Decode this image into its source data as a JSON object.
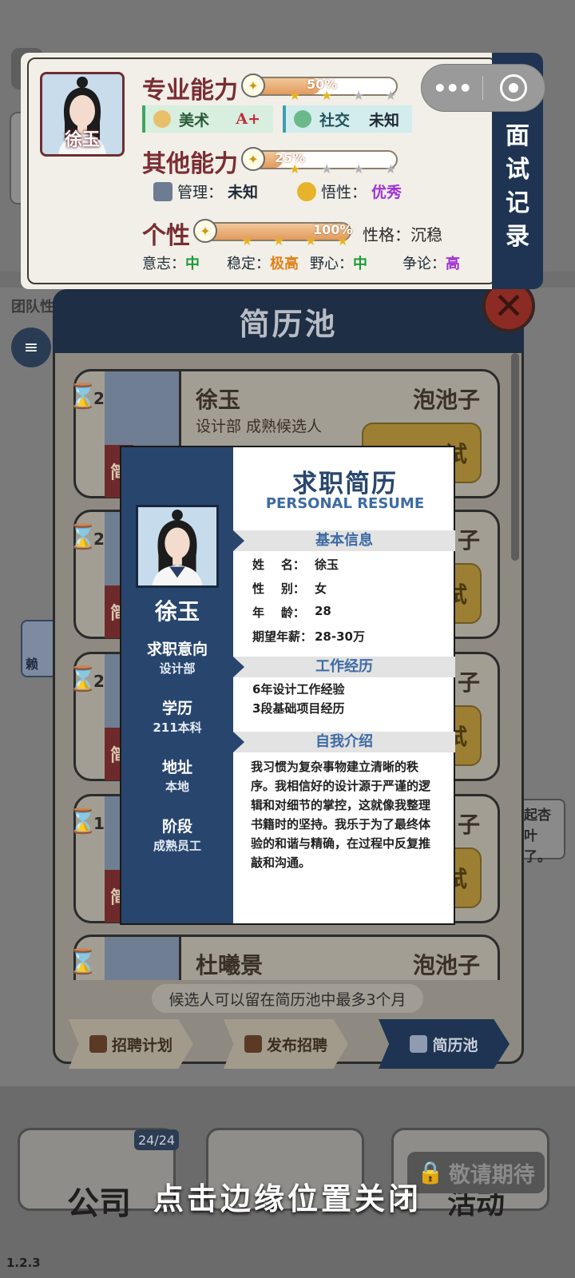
{
  "ability_panel": {
    "professional": {
      "heading": "专业能力",
      "percent_text": "50%",
      "percent": 50,
      "stars_filled": 2,
      "stars_total": 4
    },
    "skills": [
      {
        "icon": "palette-icon",
        "label": "美术",
        "value": "A+"
      },
      {
        "icon": "chat-bubble-icon",
        "label": "社交",
        "value": "未知"
      }
    ],
    "other": {
      "heading": "其他能力",
      "percent_text": "25%",
      "percent": 25,
      "stars_filled": 1,
      "stars_total": 4
    },
    "other_items": [
      {
        "icon": "team-icon",
        "label": "管理：",
        "value": "未知"
      },
      {
        "icon": "lightbulb-icon",
        "label": "悟性：",
        "value": "优秀"
      }
    ],
    "personality": {
      "heading": "个性",
      "percent_text": "100%",
      "percent": 100,
      "stars_filled": 4,
      "stars_total": 4,
      "character_label": "性格：",
      "character_value": "沉稳"
    },
    "traits": [
      {
        "label": "意志：",
        "value": "中",
        "color": "#1d9a38"
      },
      {
        "label": "稳定：",
        "value": "极高",
        "color": "#e0821a"
      },
      {
        "label": "野心：",
        "value": "中",
        "color": "#1d9a38"
      },
      {
        "label": "争论：",
        "value": "高",
        "color": "#a232d6"
      }
    ],
    "avatar_name": "徐玉",
    "interview_record": [
      "面",
      "试",
      "记",
      "录"
    ]
  },
  "background": {
    "team_label": "团队性",
    "lai_name": "赖",
    "side_bubble": [
      "起杏叶",
      "了。"
    ]
  },
  "pool": {
    "title": "简历池",
    "note": "候选人可以留在简历池中最多3个月",
    "tabs": [
      {
        "label": "招聘计划",
        "icon": "recruit-plan-icon"
      },
      {
        "label": "发布招聘",
        "icon": "publish-icon"
      },
      {
        "label": "简历池",
        "icon": "stack-icon"
      }
    ],
    "candidates": [
      {
        "wait": "2",
        "name": "徐玉",
        "sub": "设计部  成熟候选人",
        "source": "泡池子",
        "tag": "简",
        "button": "试"
      },
      {
        "wait": "2",
        "name": "",
        "sub": "",
        "source": "子",
        "tag": "简",
        "button": "试"
      },
      {
        "wait": "2",
        "name": "",
        "sub": "",
        "source": "子",
        "tag": "简",
        "button": "试"
      },
      {
        "wait": "1",
        "name": "",
        "sub": "",
        "source": "子",
        "tag": "简",
        "button": "试"
      },
      {
        "wait": "",
        "name": "杜曦景",
        "sub": "",
        "source": "泡池子",
        "tag": "",
        "button": ""
      }
    ]
  },
  "resume": {
    "title": "求职简历",
    "subtitle": "PERSONAL RESUME",
    "name": "徐玉",
    "left_fields": [
      {
        "label": "求职意向",
        "value": "设计部"
      },
      {
        "label": "学历",
        "value": "211本科"
      },
      {
        "label": "地址",
        "value": "本地"
      },
      {
        "label": "阶段",
        "value": "成熟员工"
      }
    ],
    "basic_title": "基本信息",
    "basic": [
      {
        "key": "姓    名：",
        "value": "徐玉"
      },
      {
        "key": "性    别：",
        "value": "女"
      },
      {
        "key": "年    龄：",
        "value": "28"
      },
      {
        "key": "期望年薪：",
        "value": "28-30万"
      }
    ],
    "work_title": "工作经历",
    "work": [
      "6年设计工作经验",
      "3段基础项目经历"
    ],
    "intro_title": "自我介绍",
    "intro": "我习惯为复杂事物建立清晰的秩序。我相信好的设计源于严谨的逻辑和对细节的掌控，这就像我整理书籍时的坚持。我乐于为了最终体验的和谐与精确，在过程中反复推敲和沟通。"
  },
  "bottom_nav": {
    "company_label": "公司",
    "company_count": "24/24",
    "coming_soon": "敬请期待",
    "event_label": "活动",
    "close_hint": "点击边缘位置关闭",
    "version": "1.2.3"
  }
}
